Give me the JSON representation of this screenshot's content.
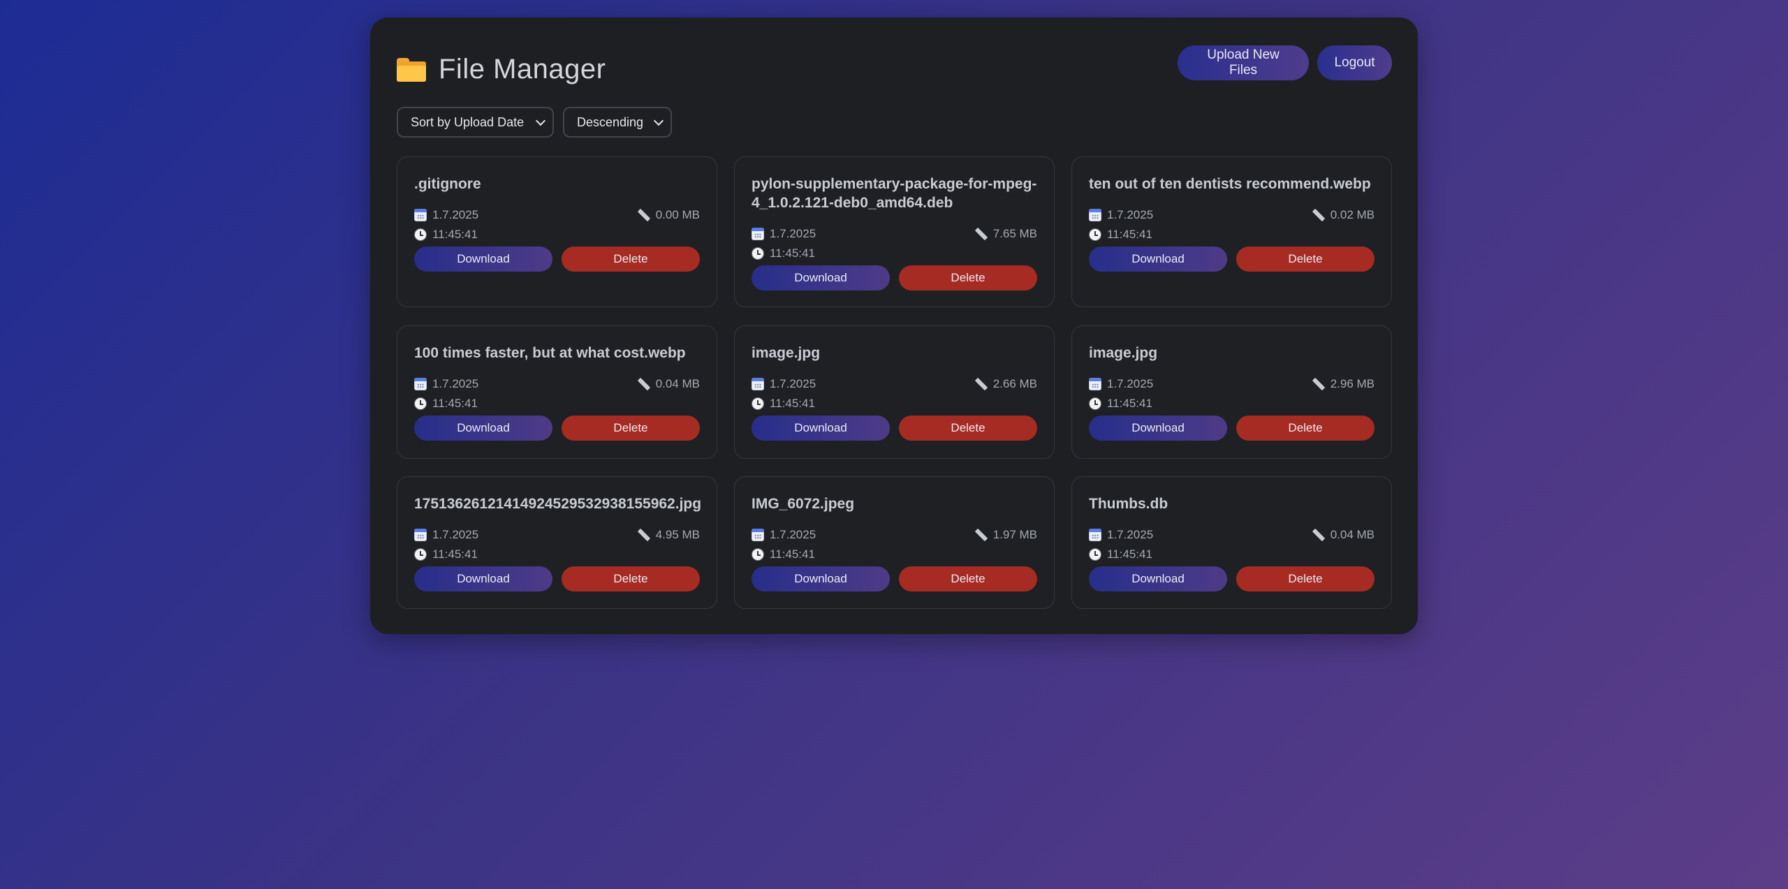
{
  "header": {
    "title": "File Manager",
    "upload_label": "Upload New Files",
    "logout_label": "Logout"
  },
  "controls": {
    "sort_by": "Sort by Upload Date",
    "order": "Descending"
  },
  "files": [
    {
      "name": ".gitignore",
      "date": "1.7.2025",
      "time": "11:45:41",
      "size": "0.00 MB",
      "download_label": "Download",
      "delete_label": "Delete"
    },
    {
      "name": "pylon-supplementary-package-for-mpeg-4_1.0.2.121-deb0_amd64.deb",
      "date": "1.7.2025",
      "time": "11:45:41",
      "size": "7.65 MB",
      "download_label": "Download",
      "delete_label": "Delete"
    },
    {
      "name": "ten out of ten dentists recommend.webp",
      "date": "1.7.2025",
      "time": "11:45:41",
      "size": "0.02 MB",
      "download_label": "Download",
      "delete_label": "Delete"
    },
    {
      "name": "100 times faster, but at what cost.webp",
      "date": "1.7.2025",
      "time": "11:45:41",
      "size": "0.04 MB",
      "download_label": "Download",
      "delete_label": "Delete"
    },
    {
      "name": "image.jpg",
      "date": "1.7.2025",
      "time": "11:45:41",
      "size": "2.66 MB",
      "download_label": "Download",
      "delete_label": "Delete"
    },
    {
      "name": "image.jpg",
      "date": "1.7.2025",
      "time": "11:45:41",
      "size": "2.96 MB",
      "download_label": "Download",
      "delete_label": "Delete"
    },
    {
      "name": "17513626121414924529532938155962.jpg",
      "date": "1.7.2025",
      "time": "11:45:41",
      "size": "4.95 MB",
      "download_label": "Download",
      "delete_label": "Delete"
    },
    {
      "name": "IMG_6072.jpeg",
      "date": "1.7.2025",
      "time": "11:45:41",
      "size": "1.97 MB",
      "download_label": "Download",
      "delete_label": "Delete"
    },
    {
      "name": "Thumbs.db",
      "date": "1.7.2025",
      "time": "11:45:41",
      "size": "0.04 MB",
      "download_label": "Download",
      "delete_label": "Delete"
    }
  ]
}
